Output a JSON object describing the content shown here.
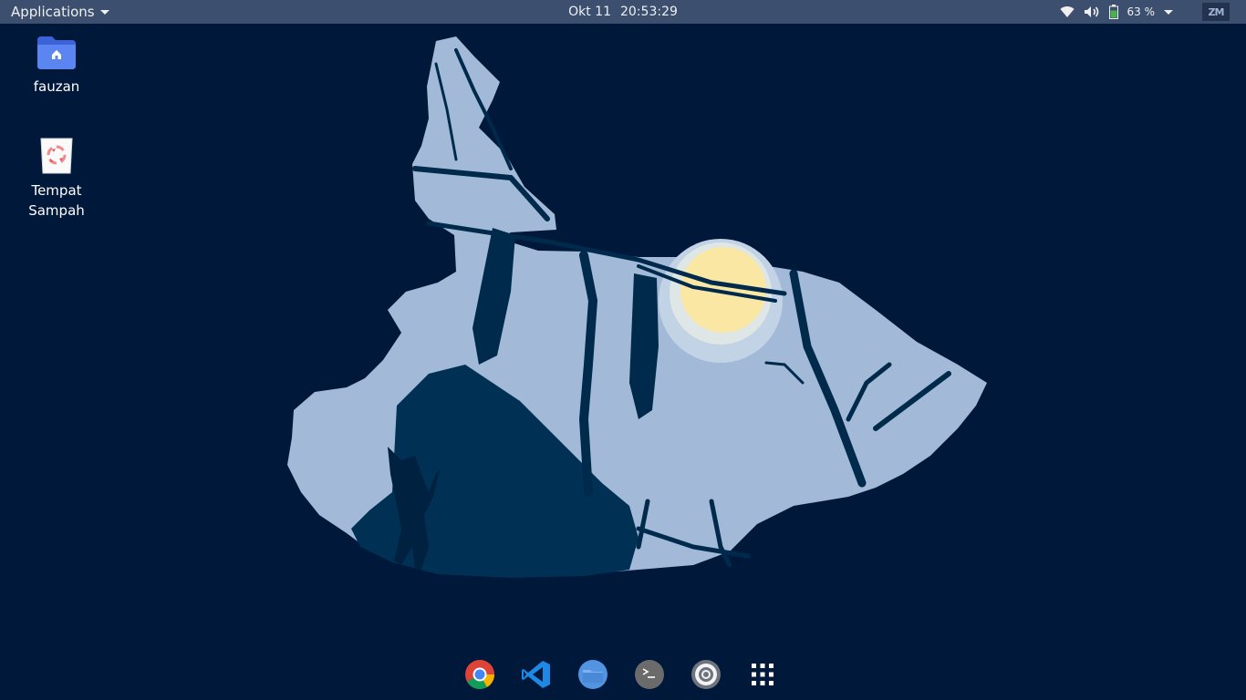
{
  "topbar": {
    "applications_label": "Applications",
    "date": "Okt 11",
    "time": "20:53:29",
    "battery_percent": "63 %",
    "profile_badge": "ZM"
  },
  "desktop": {
    "icons": [
      {
        "label": "fauzan",
        "icon": "home-folder-icon"
      },
      {
        "label": "Tempat Sampah",
        "icon": "trash-icon"
      }
    ]
  },
  "dock": {
    "items": [
      {
        "icon": "chrome-icon"
      },
      {
        "icon": "vscode-icon"
      },
      {
        "icon": "files-icon"
      },
      {
        "icon": "terminal-icon"
      },
      {
        "icon": "screenshot-icon"
      },
      {
        "icon": "app-grid-icon"
      }
    ]
  },
  "colors": {
    "topbar_bg": "#3d4f6e",
    "desktop_bg": "#00183a",
    "wallpaper_light": "#a2bad8",
    "wallpaper_dark": "#002e52",
    "moon": "#fbe7a4"
  }
}
